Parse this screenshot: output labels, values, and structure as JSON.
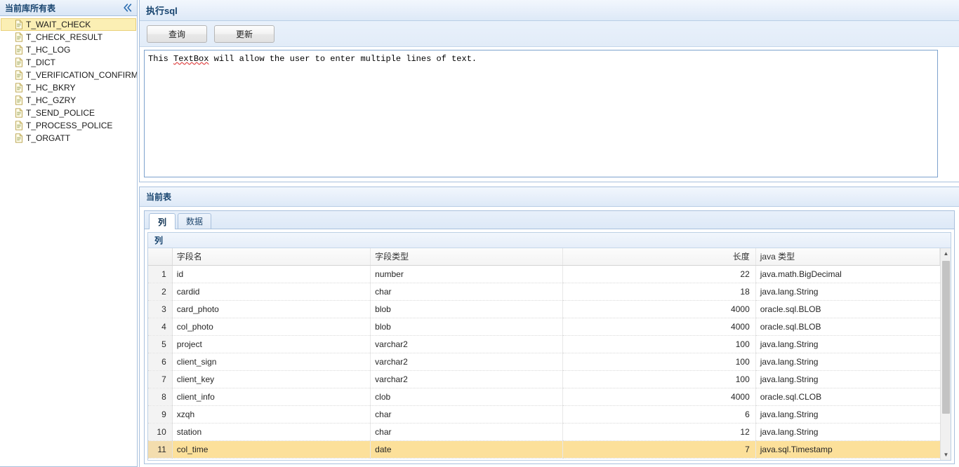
{
  "left_panel": {
    "title": "当前库所有表",
    "collapse_icon": "chevron-double-left-icon",
    "tables": [
      {
        "name": "T_WAIT_CHECK",
        "selected": true
      },
      {
        "name": "T_CHECK_RESULT",
        "selected": false
      },
      {
        "name": "T_HC_LOG",
        "selected": false
      },
      {
        "name": "T_DICT",
        "selected": false
      },
      {
        "name": "T_VERIFICATION_CONFIRM",
        "selected": false
      },
      {
        "name": "T_HC_BKRY",
        "selected": false
      },
      {
        "name": "T_HC_GZRY",
        "selected": false
      },
      {
        "name": "T_SEND_POLICE",
        "selected": false
      },
      {
        "name": "T_PROCESS_POLICE",
        "selected": false
      },
      {
        "name": "T_ORGATT",
        "selected": false
      }
    ]
  },
  "sql_panel": {
    "title": "执行sql",
    "buttons": [
      {
        "label": "查询",
        "name": "query-button"
      },
      {
        "label": "更新",
        "name": "update-button"
      }
    ],
    "editor": {
      "value_before": "This ",
      "value_misspelled": "TextBox",
      "value_after": " will allow the user to enter multiple lines of text.",
      "full_value": "This TextBox will allow the user to enter multiple lines of text.",
      "placeholder": ""
    }
  },
  "current_table_panel": {
    "title": "当前表",
    "tabs": [
      {
        "label": "列",
        "active": true
      },
      {
        "label": "数据",
        "active": false
      }
    ],
    "grid_caption": "列",
    "columns": [
      "",
      "字段名",
      "字段类型",
      "长度",
      "java 类型"
    ],
    "rows": [
      {
        "no": "1",
        "field": "id",
        "type": "number",
        "length": "22",
        "java": "java.math.BigDecimal",
        "selected": false
      },
      {
        "no": "2",
        "field": "cardid",
        "type": "char",
        "length": "18",
        "java": "java.lang.String",
        "selected": false
      },
      {
        "no": "3",
        "field": "card_photo",
        "type": "blob",
        "length": "4000",
        "java": "oracle.sql.BLOB",
        "selected": false
      },
      {
        "no": "4",
        "field": "col_photo",
        "type": "blob",
        "length": "4000",
        "java": "oracle.sql.BLOB",
        "selected": false
      },
      {
        "no": "5",
        "field": "project",
        "type": "varchar2",
        "length": "100",
        "java": "java.lang.String",
        "selected": false
      },
      {
        "no": "6",
        "field": "client_sign",
        "type": "varchar2",
        "length": "100",
        "java": "java.lang.String",
        "selected": false
      },
      {
        "no": "7",
        "field": "client_key",
        "type": "varchar2",
        "length": "100",
        "java": "java.lang.String",
        "selected": false
      },
      {
        "no": "8",
        "field": "client_info",
        "type": "clob",
        "length": "4000",
        "java": "oracle.sql.CLOB",
        "selected": false
      },
      {
        "no": "9",
        "field": "xzqh",
        "type": "char",
        "length": "6",
        "java": "java.lang.String",
        "selected": false
      },
      {
        "no": "10",
        "field": "station",
        "type": "char",
        "length": "12",
        "java": "java.lang.String",
        "selected": false
      },
      {
        "no": "11",
        "field": "col_time",
        "type": "date",
        "length": "7",
        "java": "java.sql.Timestamp",
        "selected": true
      }
    ],
    "scrollbar": {
      "up_arrow": "scroll-up-arrow-icon",
      "down_arrow": "scroll-down-arrow-icon"
    }
  },
  "colors": {
    "panel_border": "#a8c0dd",
    "header_text": "#16436e",
    "selection_yellow": "#fce09a",
    "tree_selection": "#fbefb4",
    "spell_error": "#e04a4a"
  }
}
